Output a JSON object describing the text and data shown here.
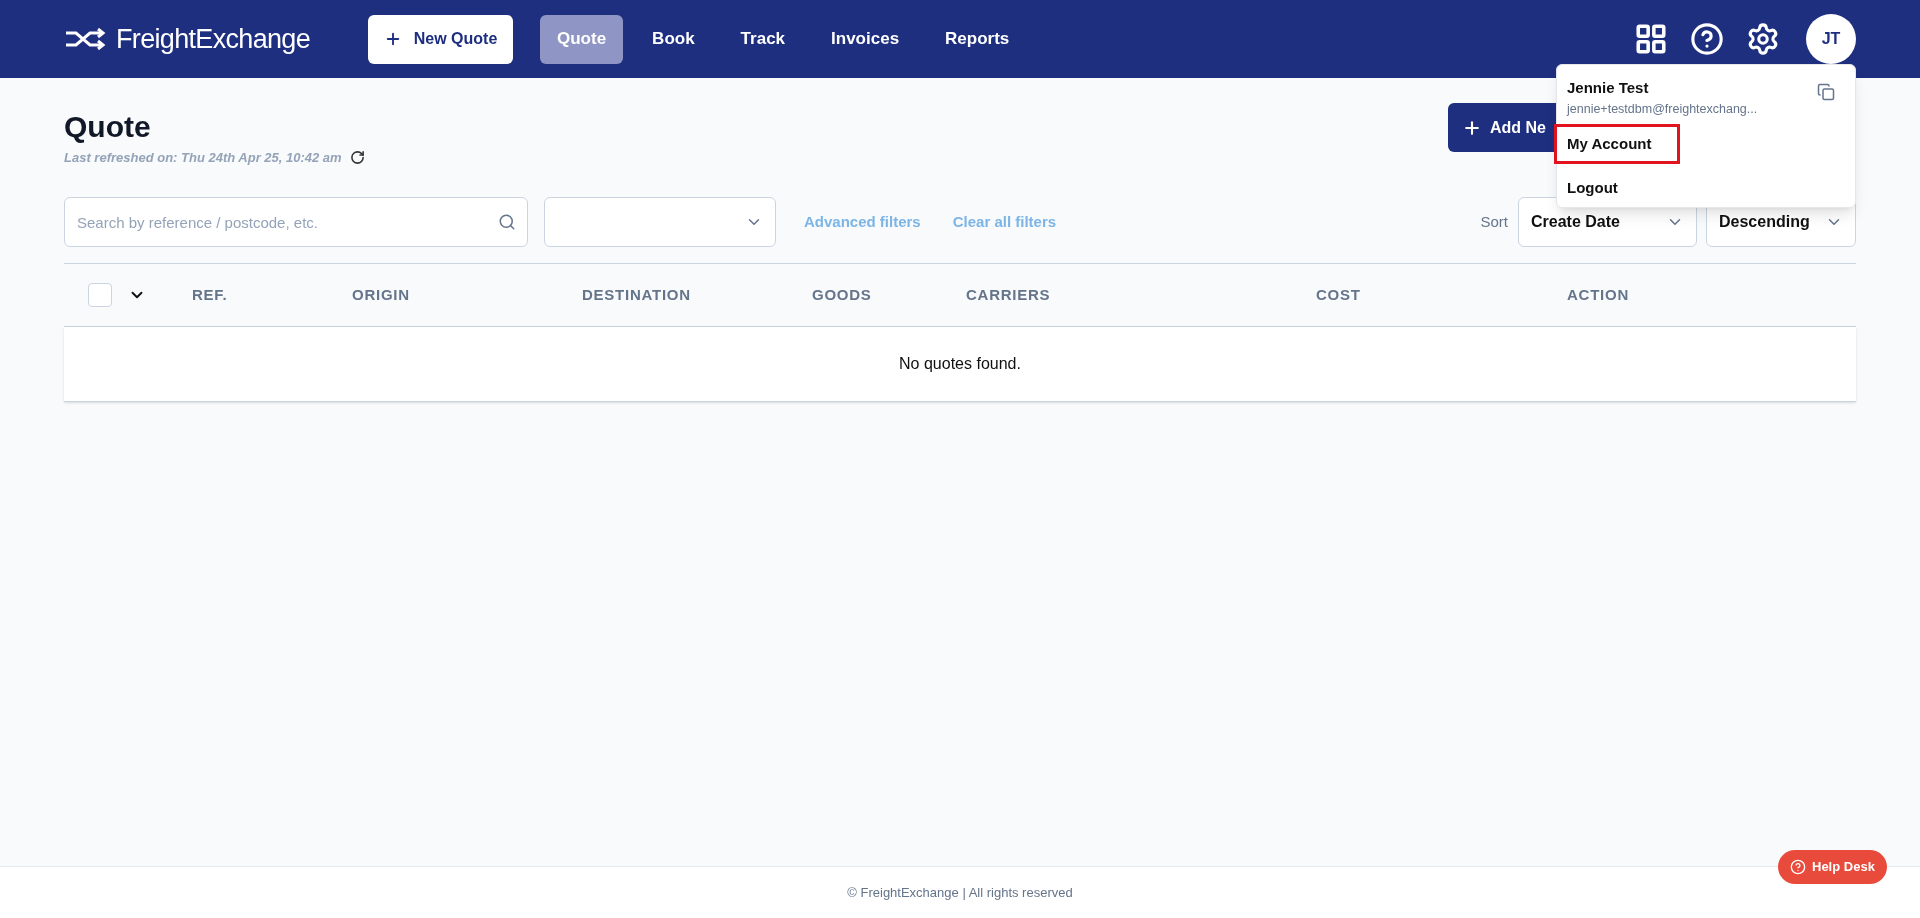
{
  "header": {
    "logo": "FreightExchange",
    "new_quote": "New Quote",
    "nav": [
      {
        "label": "Quote",
        "selected": true
      },
      {
        "label": "Book",
        "selected": false
      },
      {
        "label": "Track",
        "selected": false
      },
      {
        "label": "Invoices",
        "selected": false
      },
      {
        "label": "Reports",
        "selected": false
      }
    ],
    "avatar": "JT"
  },
  "account_menu": {
    "name": "Jennie Test",
    "email": "jennie+testdbm@freightexchang...",
    "items": [
      {
        "label": "My Account",
        "highlighted": true
      },
      {
        "label": "Logout",
        "highlighted": false
      }
    ]
  },
  "page": {
    "title": "Quote",
    "refreshed": "Last refreshed on: Thu 24th Apr 25, 10:42 am",
    "add_button": "Add Ne"
  },
  "filters": {
    "search_placeholder": "Search by reference / postcode, etc.",
    "advanced": "Advanced filters",
    "clear": "Clear all filters",
    "sort_label": "Sort",
    "sort_field": "Create Date",
    "sort_order": "Descending"
  },
  "table": {
    "select_all": false,
    "columns": [
      "REF.",
      "ORIGIN",
      "DESTINATION",
      "GOODS",
      "CARRIERS",
      "COST",
      "ACTION"
    ],
    "empty": "No quotes found."
  },
  "footer": "© FreightExchange | All rights reserved",
  "help_desk": "Help Desk"
}
